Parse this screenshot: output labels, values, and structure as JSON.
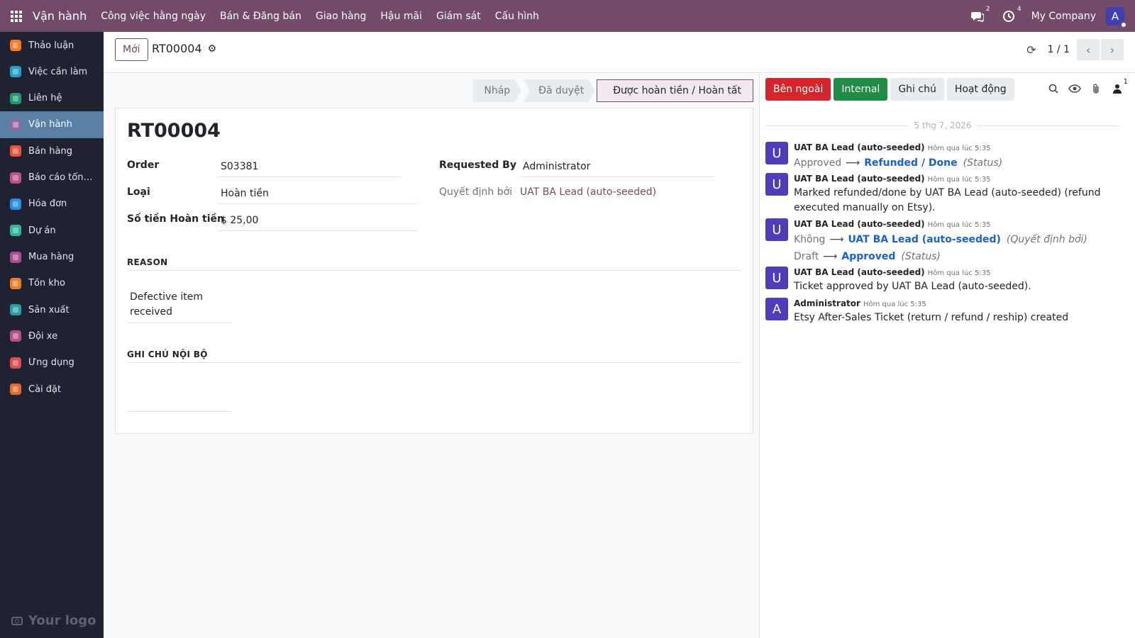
{
  "navbar": {
    "brand": "Vận hành",
    "menu": [
      "Công việc hằng ngày",
      "Bán & Đăng bán",
      "Giao hàng",
      "Hậu mãi",
      "Giám sát",
      "Cấu hình"
    ],
    "messages_count": "2",
    "activities_count": "4",
    "company": "My Company",
    "avatar_letter": "A"
  },
  "sidebar": {
    "items": [
      {
        "label": "Thảo luận",
        "icon": "chat-icon",
        "color": "#f57c26"
      },
      {
        "label": "Việc cần làm",
        "icon": "todo-icon",
        "color": "#26a0c8"
      },
      {
        "label": "Liên hệ",
        "icon": "contacts-icon",
        "color": "#1f9c6f"
      },
      {
        "label": "Vận hành",
        "icon": "operations-icon",
        "color": "#8e6aa6"
      },
      {
        "label": "Bán hàng",
        "icon": "sales-icon",
        "color": "#e8563a"
      },
      {
        "label": "Báo cáo tổng ...",
        "icon": "reports-icon",
        "color": "#c04f8e"
      },
      {
        "label": "Hóa đơn",
        "icon": "invoice-icon",
        "color": "#2c8ee0"
      },
      {
        "label": "Dự án",
        "icon": "project-icon",
        "color": "#2fb59a"
      },
      {
        "label": "Mua hàng",
        "icon": "purchase-icon",
        "color": "#a94e8f"
      },
      {
        "label": "Tồn kho",
        "icon": "inventory-icon",
        "color": "#e87c2f"
      },
      {
        "label": "Sản xuất",
        "icon": "manufacturing-icon",
        "color": "#27a0a3"
      },
      {
        "label": "Đội xe",
        "icon": "fleet-icon",
        "color": "#b5508d"
      },
      {
        "label": "Ứng dụng",
        "icon": "apps-icon",
        "color": "#e04e4e"
      },
      {
        "label": "Cài đặt",
        "icon": "settings-icon",
        "color": "#e8692f"
      }
    ],
    "active_index": 3,
    "logo_text": "Your logo"
  },
  "control": {
    "new_label": "Mới",
    "breadcrumb": "RT00004",
    "pager_value": "1 / 1"
  },
  "statusbar": {
    "stages": [
      "Nháp",
      "Đã duyệt",
      "Được hoàn tiền / Hoàn tất"
    ],
    "current": "Được hoàn tiền / Hoàn tất"
  },
  "form": {
    "title": "RT00004",
    "order_label": "Order",
    "order_value": "S03381",
    "type_label": "Loại",
    "type_value": "Hoàn tiền",
    "amount_label": "Số tiền Hoàn tiền",
    "amount_value": "$ 25,00",
    "requested_by_label": "Requested By",
    "requested_by_value": "Administrator",
    "decided_by_label": "Quyết định bởi",
    "decided_by_value": "UAT BA Lead (auto-seeded)",
    "reason_title": "REASON",
    "reason_value": "Defective item received",
    "note_title": "GHI CHÚ NỘI BỘ"
  },
  "chatter": {
    "buttons": {
      "external": "Bên ngoài",
      "internal": "Internal",
      "note": "Ghi chú",
      "activity": "Hoạt động"
    },
    "followers_count": "1",
    "date_separator": "5 thg 7, 2026",
    "messages": [
      {
        "avatar": "U",
        "author": "UAT BA Lead (auto-seeded)",
        "time": "Hôm qua lúc 5:35",
        "tracking": [
          {
            "old": "Approved",
            "new": "Refunded / Done",
            "field": "(Status)"
          }
        ]
      },
      {
        "avatar": "U",
        "author": "UAT BA Lead (auto-seeded)",
        "time": "Hôm qua lúc 5:35",
        "text": "Marked refunded/done by UAT BA Lead (auto-seeded) (refund executed manually on Etsy)."
      },
      {
        "avatar": "U",
        "author": "UAT BA Lead (auto-seeded)",
        "time": "Hôm qua lúc 5:35",
        "tracking": [
          {
            "old": "Không",
            "new": "UAT BA Lead (auto-seeded)",
            "field": "(Quyết định bởi)"
          },
          {
            "old": "Draft",
            "new": "Approved",
            "field": "(Status)"
          }
        ]
      },
      {
        "avatar": "U",
        "author": "UAT BA Lead (auto-seeded)",
        "time": "Hôm qua lúc 5:35",
        "text": "Ticket approved by UAT BA Lead (auto-seeded)."
      },
      {
        "avatar": "A",
        "author": "Administrator",
        "time": "Hôm qua lúc 5:35",
        "text": "Etsy After-Sales Ticket (return / refund / reship) created"
      }
    ]
  }
}
